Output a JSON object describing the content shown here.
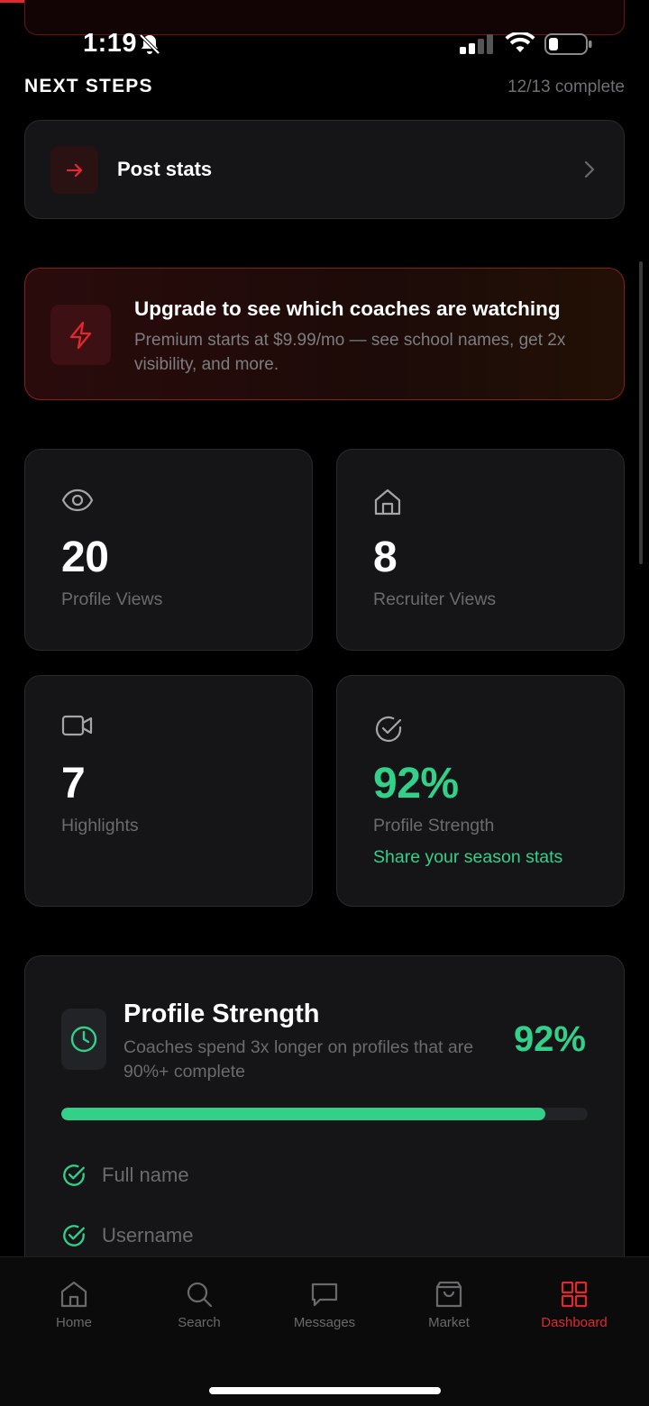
{
  "status_bar": {
    "time": "1:19"
  },
  "next_steps": {
    "title": "NEXT STEPS",
    "count": "12/13 complete",
    "items": [
      {
        "label": "Post stats",
        "icon": "arrow-right-icon"
      }
    ]
  },
  "upgrade": {
    "title": "Upgrade to see which coaches are watching",
    "description": "Premium starts at $9.99/mo — see school names, get 2x visibility, and more.",
    "icon": "lightning-icon"
  },
  "stats": [
    {
      "icon": "eye-icon",
      "value": "20",
      "label": "Profile Views"
    },
    {
      "icon": "building-icon",
      "value": "8",
      "label": "Recruiter Views"
    },
    {
      "icon": "video-icon",
      "value": "7",
      "label": "Highlights"
    },
    {
      "icon": "check-circle-icon",
      "value": "92%",
      "label": "Profile Strength",
      "link": "Share your season stats"
    }
  ],
  "profile_strength": {
    "title": "Profile Strength",
    "description": "Coaches spend 3x longer on profiles that are 90%+ complete",
    "percent_label": "92%",
    "progress": 0.92,
    "checklist": [
      {
        "label": "Full name",
        "done": true
      },
      {
        "label": "Username",
        "done": true
      }
    ]
  },
  "tabs": [
    {
      "label": "Home",
      "icon": "home-icon"
    },
    {
      "label": "Search",
      "icon": "search-icon"
    },
    {
      "label": "Messages",
      "icon": "message-icon"
    },
    {
      "label": "Market",
      "icon": "shopping-bag-icon"
    },
    {
      "label": "Dashboard",
      "icon": "dashboard-grid-icon",
      "active": true
    }
  ],
  "colors": {
    "accent": "#e0282e",
    "success": "#33d08a",
    "background": "#000000",
    "card": "#151517"
  }
}
